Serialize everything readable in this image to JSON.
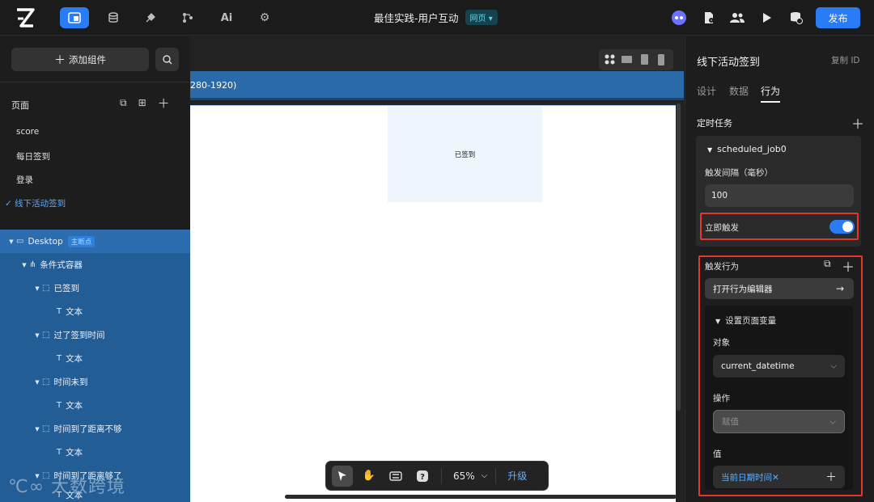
{
  "header": {
    "title": "最佳实践-用户互动",
    "web_badge": "网页 ▾",
    "publish": "发布",
    "left_icons": [
      "pages-icon",
      "database-icon",
      "plugin-icon",
      "flow-icon",
      "ai-icon",
      "gear-icon"
    ],
    "right_icons": [
      "ai-assistant-icon",
      "document-icon",
      "users-icon",
      "play-icon",
      "deploy-icon"
    ]
  },
  "left": {
    "add_component": "添加组件",
    "pages_label": "页面",
    "pages": [
      "score",
      "每日签到",
      "登录",
      "线下活动签到"
    ],
    "active_page": "线下活动签到",
    "tree": [
      {
        "label": "Desktop",
        "badge": "主断点",
        "depth": 0,
        "icon": "▭"
      },
      {
        "label": "条件式容器",
        "depth": 1,
        "icon": "⋔"
      },
      {
        "label": "已签到",
        "depth": 2,
        "icon": "⬚"
      },
      {
        "label": "文本",
        "depth": 3,
        "icon": "T"
      },
      {
        "label": "过了签到时间",
        "depth": 2,
        "icon": "⬚"
      },
      {
        "label": "文本",
        "depth": 3,
        "icon": "T"
      },
      {
        "label": "时间未到",
        "depth": 2,
        "icon": "⬚"
      },
      {
        "label": "文本",
        "depth": 3,
        "icon": "T"
      },
      {
        "label": "时间到了距离不够",
        "depth": 2,
        "icon": "⬚"
      },
      {
        "label": "文本",
        "depth": 3,
        "icon": "T"
      },
      {
        "label": "时间到了距离够了",
        "depth": 2,
        "icon": "⬚"
      },
      {
        "label": "文本",
        "depth": 3,
        "icon": "T"
      }
    ]
  },
  "canvas": {
    "breakpoint_text": "280-1920)",
    "signed_text": "已签到",
    "zoom": "65%",
    "upgrade": "升级"
  },
  "right": {
    "title": "线下活动签到",
    "copy_id": "复制 ID",
    "tabs": [
      "设计",
      "数据",
      "行为"
    ],
    "active_tab": "行为",
    "scheduled_label": "定时任务",
    "job_name": "scheduled_job0",
    "interval_label": "触发间隔（毫秒）",
    "interval_value": "100",
    "immediate_label": "立即触发",
    "immediate_on": true,
    "trigger_label": "触发行为",
    "open_editor": "打开行为编辑器",
    "action_title": "设置页面变量",
    "object_label": "对象",
    "object_value": "current_datetime",
    "operation_label": "操作",
    "operation_value": "赋值",
    "value_label": "值",
    "value_value": "当前日期时间✕"
  },
  "watermark": "大数跨境",
  "colors": {
    "accent": "#2a7bf6",
    "highlight": "#e0392d",
    "tree_bg": "#235d96"
  }
}
